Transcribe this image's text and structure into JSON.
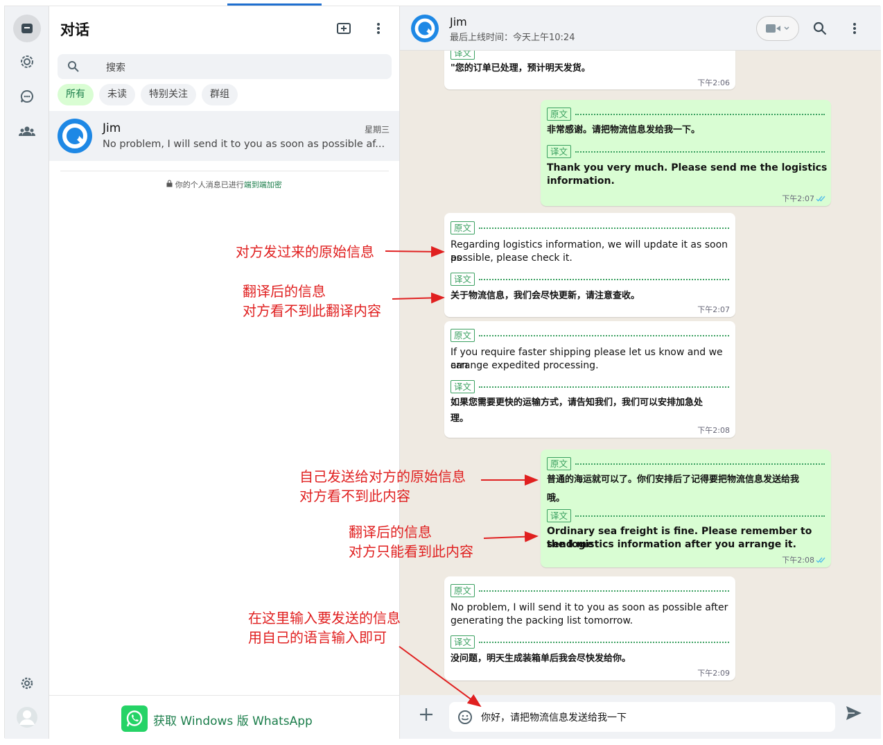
{
  "sidebar": {
    "title": "对话",
    "search_placeholder": "搜索",
    "filters": [
      "所有",
      "未读",
      "特别关注",
      "群组"
    ],
    "chat": {
      "name": "Jim",
      "time": "星期三",
      "preview": "No problem, I will send it to you as soon as possible af..."
    },
    "e2e_prefix": "你的个人消息已进行",
    "e2e_link": "端到端加密",
    "footer": "获取 Windows 版 WhatsApp"
  },
  "header": {
    "name": "Jim",
    "status": "最后上线时间：今天上午10:24"
  },
  "messages": {
    "m0": {
      "tag": "译文",
      "text": "\"您的订单已处理，预计明天发货。",
      "time": "下午2:06"
    },
    "m1": {
      "tag1": "原文",
      "text1": "非常感谢。请把物流信息发给我一下。",
      "tag2": "译文",
      "text2a": "Thank you very much. Please send me the logistics",
      "text2b": "information.",
      "time": "下午2:07"
    },
    "m2": {
      "tag1": "原文",
      "text1a": "Regarding logistics information, we will update it as soon as",
      "text1b": "possible, please check it.",
      "tag2": "译文",
      "text2": "关于物流信息，我们会尽快更新，请注意查收。",
      "time": "下午2:07"
    },
    "m3": {
      "tag1": "原文",
      "text1a": "If you require faster shipping please let us know and we can",
      "text1b": "arrange expedited processing.",
      "tag2": "译文",
      "text2a": "如果您需要更快的运输方式，请告知我们，我们可以安排加急处",
      "text2b": "理。",
      "time": "下午2:08"
    },
    "m4": {
      "tag1": "原文",
      "text1a": "普通的海运就可以了。你们安排后了记得要把物流信息发送给我",
      "text1b": "哦。",
      "tag2": "译文",
      "text2a": "Ordinary sea freight is fine. Please remember to send me",
      "text2b": "the logistics information after you arrange it.",
      "time": "下午2:08"
    },
    "m5": {
      "tag1": "原文",
      "text1a": "No problem, I will send it to you as soon as possible after",
      "text1b": "generating the packing list tomorrow.",
      "tag2": "译文",
      "text2": "没问题，明天生成装箱单后我会尽快发给你。",
      "time": "下午2:09"
    }
  },
  "composer": {
    "value": "你好，请把物流信息发送给我一下"
  },
  "annotations": {
    "a1": "对方发过来的原始信息",
    "a2a": "翻译后的信息",
    "a2b": "对方看不到此翻译内容",
    "a3a": "自己发送给对方的原始信息",
    "a3b": "对方看不到此内容",
    "a4a": "翻译后的信息",
    "a4b": "对方只能看到此内容",
    "a5a": "在这里输入要发送的信息",
    "a5b": "用自己的语言输入即可"
  },
  "colors": {
    "accent": "#1a7d4a",
    "outgoing": "#d9fdd3",
    "annotation": "#e02020",
    "tag": "#3aa060"
  }
}
